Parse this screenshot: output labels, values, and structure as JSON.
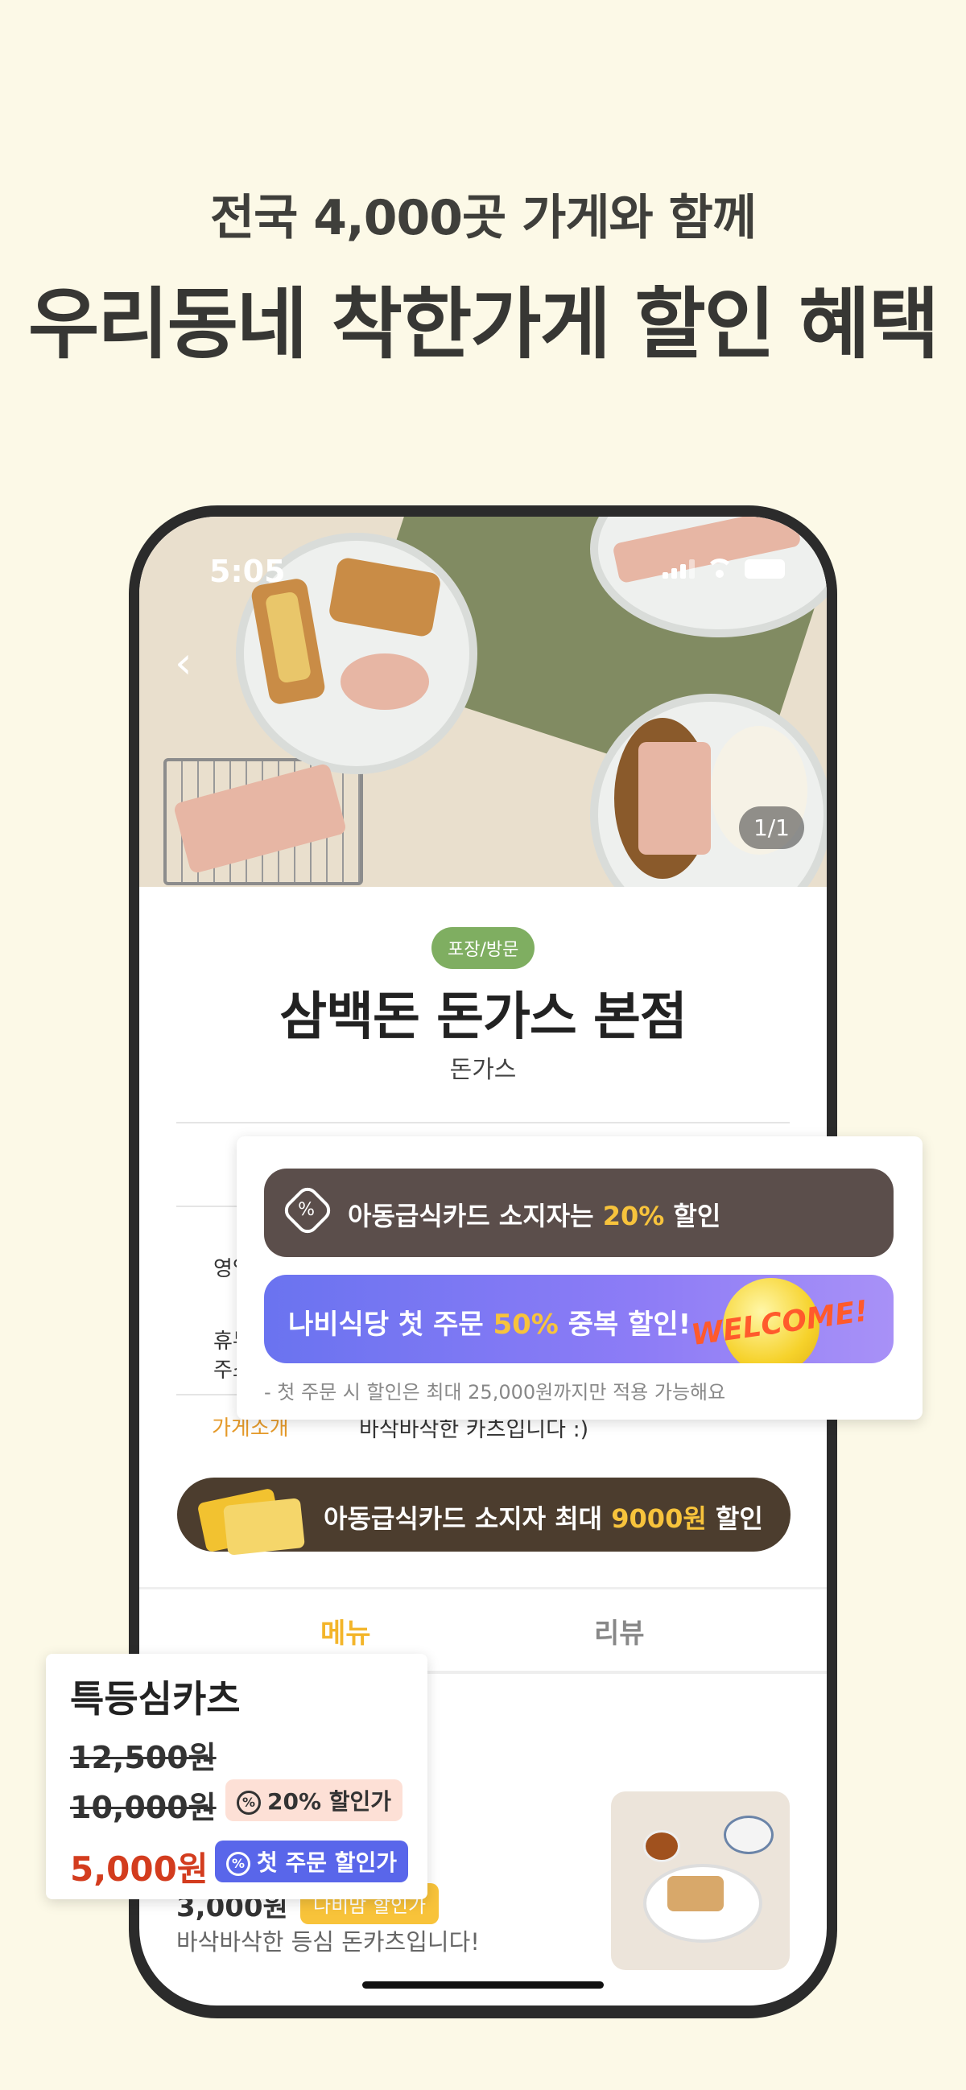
{
  "promo": {
    "line1": "전국 4,000곳 가게와 함께",
    "line2": "우리동네 착한가게 할인 혜택"
  },
  "status_bar": {
    "time": "5:05"
  },
  "hero": {
    "image_counter": "1/1"
  },
  "store": {
    "tag": "포장/방문",
    "name": "삼백돈 돈가스 본점",
    "category": "돈가스",
    "info_labels": [
      "영업",
      "휴무",
      "주소"
    ],
    "intro_label": "가게소개",
    "intro_text": "바삭바삭한 카츠입니다 :)"
  },
  "card_banner": {
    "text_before": "아동급식카드 소지자 최대 ",
    "highlight": "9000원",
    "text_after": " 할인"
  },
  "tabs": [
    {
      "label": "메뉴",
      "active": true
    },
    {
      "label": "리뷰",
      "active": false
    }
  ],
  "menu_item": {
    "price": "3,000원",
    "badge": "나비맘 할인가",
    "description": "바삭바삭한 등심 돈카츠입니다!"
  },
  "coupons": {
    "row1": {
      "before": "아동급식카드 소지자는 ",
      "highlight": "20%",
      "after": " 할인"
    },
    "row2": {
      "before": "나비식당 첫 주문 ",
      "highlight": "50%",
      "after": " 중복 할인!",
      "sticker": "WELCOME!"
    },
    "note": "- 첫 주문 시 할인은 최대 25,000원까지만 적용 가능해요"
  },
  "price_card": {
    "name": "특등심카츠",
    "original_price": "12,500원",
    "discount_price": "10,000원",
    "discount_badge": "20% 할인가",
    "final_price": "5,000원",
    "final_badge": "첫 주문 할인가"
  },
  "colors": {
    "background": "#fcf9e7",
    "accent_yellow": "#f7c33c",
    "tab_active": "#f3b52a",
    "brown": "#4c3d2e",
    "final_price": "#d33c1e",
    "blue_badge": "#5966ea"
  }
}
